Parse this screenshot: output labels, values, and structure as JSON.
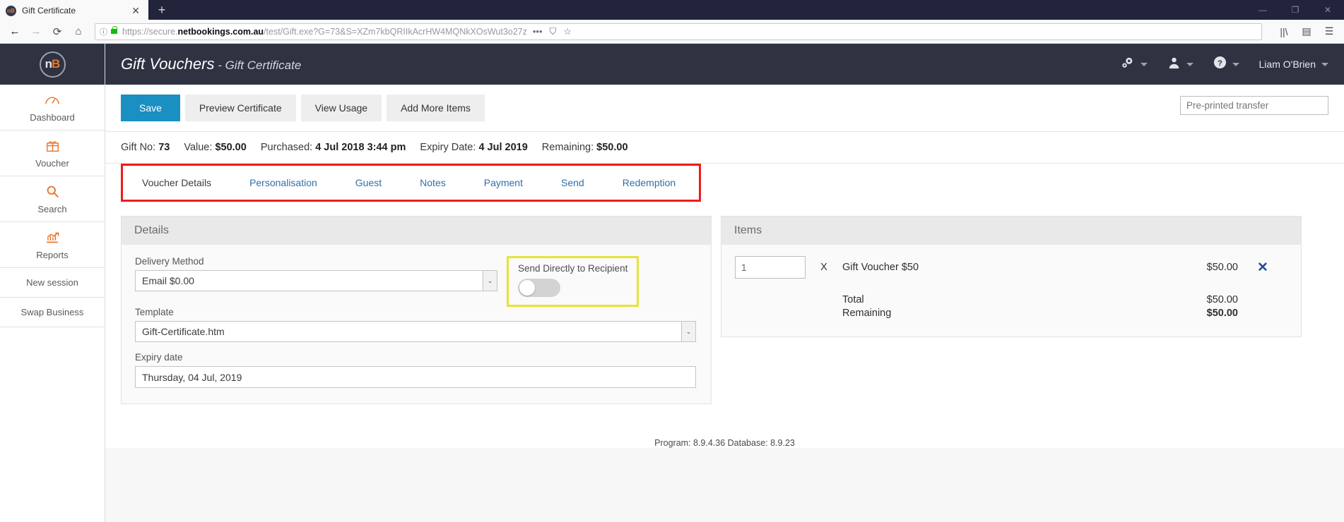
{
  "browser": {
    "tab_title": "Gift Certificate",
    "favicon_label": "nB",
    "close_tab": "✕",
    "new_tab": "+",
    "window_controls": {
      "minimize": "―",
      "maximize": "❐",
      "close": "✕"
    },
    "nav": {
      "back": "←",
      "forward": "→",
      "reload": "⟳",
      "home": "⌂"
    },
    "url_prefix": "https://secure.",
    "url_domain": "netbookings.com.au",
    "url_suffix": "/test/Gift.exe?G=73&S=XZm7kbQRIIkAcrHW4MQNkXOsWut3o27z",
    "url_full": "https://secure.netbookings.com.au/test/Gift.exe?G=73&S=XZm7kbQRIIkAcrHW4MQNkXOsWut3o27z",
    "icons": {
      "page_actions": "•••",
      "pocket": "⛉",
      "bookmark": "☆",
      "library": "||\\",
      "sidebar": "▤",
      "menu": "☰"
    }
  },
  "sidebar": {
    "brand": {
      "n": "n",
      "b": "B"
    },
    "items": [
      {
        "label": "Dashboard",
        "icon": "dashboard-gauge-icon",
        "glyph": "◠"
      },
      {
        "label": "Voucher",
        "icon": "gift-icon",
        "glyph": "🎁"
      },
      {
        "label": "Search",
        "icon": "magnifier-icon",
        "glyph": "🔍"
      },
      {
        "label": "Reports",
        "icon": "chart-up-icon",
        "glyph": "📈"
      },
      {
        "label": "New session",
        "icon": "",
        "glyph": ""
      },
      {
        "label": "Swap Business",
        "icon": "",
        "glyph": ""
      }
    ]
  },
  "header": {
    "title": "Gift Vouchers",
    "separator": " - ",
    "subtitle": "Gift Certificate",
    "settings_icon": "gears-icon",
    "user_switch_icon": "person-icon",
    "help_icon": "question-circle-icon",
    "username": "Liam O'Brien"
  },
  "toolbar": {
    "save_label": "Save",
    "preview_label": "Preview Certificate",
    "view_usage_label": "View Usage",
    "add_items_label": "Add More Items",
    "preprinted_placeholder": "Pre-printed transfer",
    "preprinted_value": ""
  },
  "infobar": [
    {
      "key": "Gift No:",
      "value": "73"
    },
    {
      "key": "Value:",
      "value": "$50.00"
    },
    {
      "key": "Purchased:",
      "value": "4 Jul 2018 3:44 pm"
    },
    {
      "key": "Expiry Date:",
      "value": "4 Jul 2019"
    },
    {
      "key": "Remaining:",
      "value": "$50.00"
    }
  ],
  "tabs": [
    {
      "label": "Voucher Details",
      "active": true
    },
    {
      "label": "Personalisation",
      "active": false
    },
    {
      "label": "Guest",
      "active": false
    },
    {
      "label": "Notes",
      "active": false
    },
    {
      "label": "Payment",
      "active": false
    },
    {
      "label": "Send",
      "active": false
    },
    {
      "label": "Redemption",
      "active": false
    }
  ],
  "details": {
    "panel_title": "Details",
    "delivery_method_label": "Delivery Method",
    "delivery_method_value": "Email $0.00",
    "template_label": "Template",
    "template_value": "Gift-Certificate.htm",
    "expiry_label": "Expiry date",
    "expiry_value": "Thursday, 04 Jul, 2019",
    "send_direct_label": "Send Directly to Recipient",
    "send_direct_state": "off",
    "dropdown_glyph": "⌄"
  },
  "items": {
    "panel_title": "Items",
    "rows": [
      {
        "qty": "1",
        "multiplier": "X",
        "name": "Gift Voucher $50",
        "price": "$50.00",
        "delete": "✕"
      }
    ],
    "totals": [
      {
        "label": "Total",
        "value": "$50.00",
        "bold": false
      },
      {
        "label": "Remaining",
        "value": "$50.00",
        "bold": true
      }
    ]
  },
  "footer": {
    "text": "Program: 8.9.4.36 Database: 8.9.23"
  },
  "colors": {
    "header_bg": "#2e3241",
    "accent_orange": "#e8762c",
    "save_blue": "#1a8fc1",
    "tab_link_blue": "#2f6fab",
    "highlight_red": "#ee1c1c",
    "highlight_yellow": "#e4e438",
    "delete_blue": "#1f4e9c"
  }
}
